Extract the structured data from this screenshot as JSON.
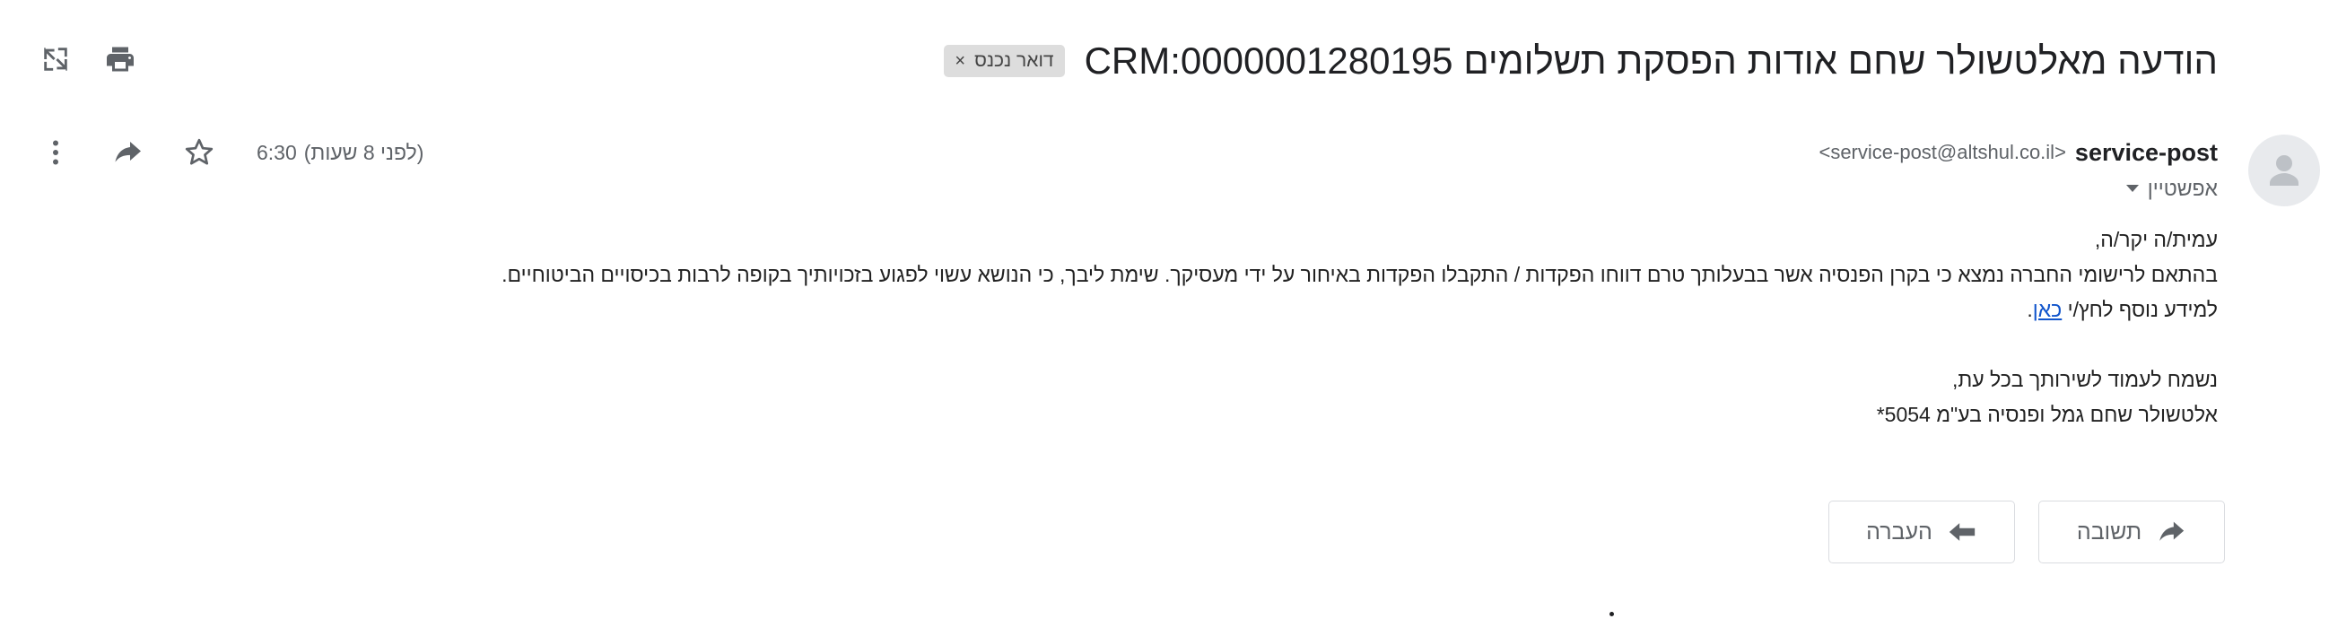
{
  "toolbar": {
    "icons": [
      "open-in-new-window-icon",
      "print-icon"
    ]
  },
  "email": {
    "subject": "הודעה מאלטשולר שחם אודות הפסקת תשלומים CRM:0000001280195",
    "label": "דואר נכנס",
    "label_close": "×",
    "sender": {
      "name": "service-post",
      "email": "<service-post@altshul.co.il>",
      "recipient": "אפשטיין"
    },
    "time": "6:30",
    "time_relative": "(לפני 8 שעות)",
    "header_actions": [
      "star-icon",
      "forward-icon",
      "more-vert-icon"
    ],
    "body": {
      "greeting": "עמית/ה יקר/ה,",
      "paragraph": "בהתאם לרישומי החברה נמצא כי בקרן הפנסיה אשר בבעלותך טרם דווחו הפקדות / התקבלו הפקדות באיחור על ידי מעסיקך. שימת ליבך, כי הנושא עשוי לפגוע בזכויותיך בקופה לרבות בכיסויים הביטוחיים.",
      "more_info_prefix": "למידע נוסף לחץ/י ",
      "more_info_link": "כאן",
      "more_info_suffix": ".",
      "closing": "נשמח לעמוד לשירותך בכל עת,",
      "signature": "אלטשולר שחם גמל ופנסיה בע\"מ 5054*"
    }
  },
  "actions": {
    "reply_label": "תשובה",
    "forward_label": "העברה"
  },
  "colors": {
    "link": "#1155cc",
    "text": "#202124",
    "muted": "#5f6368",
    "chip_bg": "#dddddd",
    "border": "#dadce0"
  }
}
